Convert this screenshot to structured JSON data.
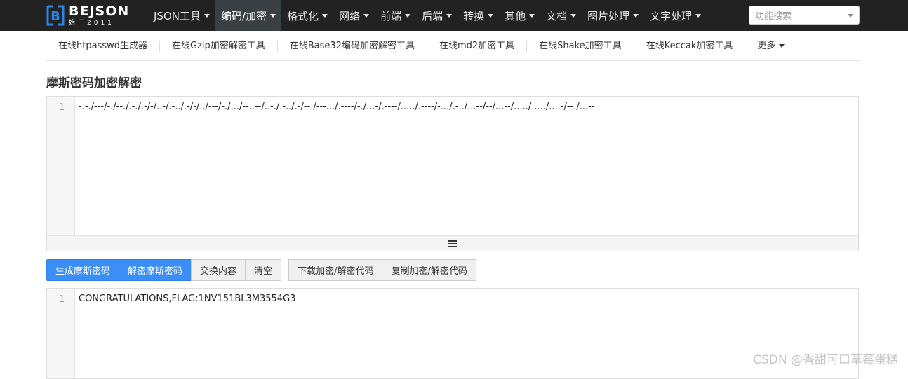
{
  "logo": {
    "title": "BEJSON",
    "subtitle": "始于2011"
  },
  "nav": {
    "items": [
      {
        "label": "JSON工具"
      },
      {
        "label": "编码/加密"
      },
      {
        "label": "格式化"
      },
      {
        "label": "网络"
      },
      {
        "label": "前端"
      },
      {
        "label": "后端"
      },
      {
        "label": "转换"
      },
      {
        "label": "其他"
      },
      {
        "label": "文档"
      },
      {
        "label": "图片处理"
      },
      {
        "label": "文字处理"
      }
    ],
    "active_index": 1,
    "search_placeholder": "功能搜索"
  },
  "subnav": {
    "items": [
      {
        "label": "在线htpasswd生成器"
      },
      {
        "label": "在线Gzip加密解密工具"
      },
      {
        "label": "在线Base32编码加密解密工具"
      },
      {
        "label": "在线md2加密工具"
      },
      {
        "label": "在线Shake加密工具"
      },
      {
        "label": "在线Keccak加密工具"
      }
    ],
    "more_label": "更多"
  },
  "page_title": "摩斯密码加密解密",
  "input_editor": {
    "line_number": "1",
    "text": "-.-./---/-./--./.-./.-/-/..-/.-../.-/-/../---/-./.../--..--/..-./.-../.-/--./---.../.----/-./...-/.----/...../.----/-.../.-../...--/--/...--/...../...../....-/--./...--"
  },
  "buttons": {
    "encode": "生成摩斯密码",
    "decode": "解密摩斯密码",
    "swap": "交换内容",
    "clear": "清空",
    "download_code": "下载加密/解密代码",
    "copy_code": "复制加密/解密代码"
  },
  "output_editor": {
    "line_number": "1",
    "text": "CONGRATULATIONS,FLAG:1NV151BL3M3554G3"
  },
  "watermark": "CSDN @香甜可口草莓蛋糕",
  "colors": {
    "navbar": "#222222",
    "primary": "#3a8ef6",
    "logo_blue": "#2a86e8"
  }
}
